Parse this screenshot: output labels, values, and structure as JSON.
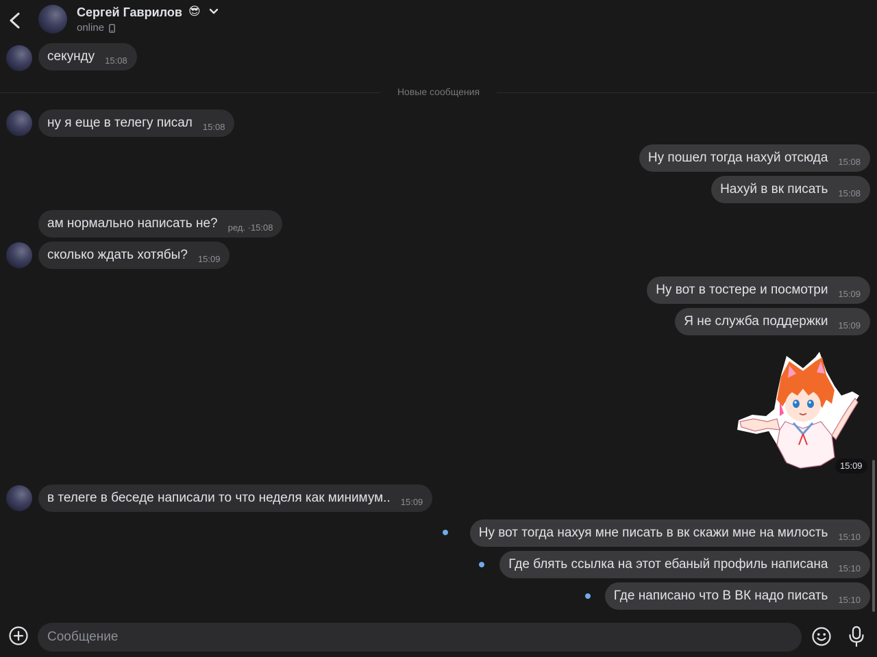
{
  "header": {
    "peer_name": "Сергей Гаврилов",
    "peer_emoji": "😎",
    "status": "online",
    "icons": [
      "back-arrow-icon",
      "chevron-down-icon",
      "phone-icon"
    ]
  },
  "divider": {
    "label": "Новые сообщения"
  },
  "messages": [
    {
      "dir": "in",
      "text": "секунду",
      "time": "15:08"
    },
    {
      "dir": "in",
      "text": "ну я еще в телегу писал",
      "time": "15:08"
    },
    {
      "dir": "out",
      "text": "Ну пошел тогда нахуй отсюда",
      "time": "15:08"
    },
    {
      "dir": "out",
      "text": "Нахуй в вк писать",
      "time": "15:08"
    },
    {
      "dir": "in",
      "text": "ам нормально написать не?",
      "edited": "ред.",
      "time": "15:08"
    },
    {
      "dir": "in",
      "text": "сколько ждать хотябы?",
      "time": "15:09"
    },
    {
      "dir": "out",
      "text": "Ну вот в тостере и посмотри",
      "time": "15:09"
    },
    {
      "dir": "out",
      "text": "Я не служба поддержки",
      "time": "15:09"
    },
    {
      "dir": "in",
      "text": "в телеге в беседе написали то что неделя как минимум..",
      "time": "15:09"
    },
    {
      "dir": "out",
      "text": "Ну вот тогда нахуя мне писать в вк скажи мне на милость",
      "time": "15:10",
      "unread": true
    },
    {
      "dir": "out",
      "text": "Где блять ссылка на этот ебаный профиль написана",
      "time": "15:10",
      "unread": true
    },
    {
      "dir": "out",
      "text": "Где написано что В ВК надо писать",
      "time": "15:10",
      "unread": true
    }
  ],
  "sticker": {
    "time": "15:09",
    "description_icon": "anime-fox-girl-sticker"
  },
  "composer": {
    "placeholder": "Сообщение",
    "icons": [
      "plus-circle-icon",
      "emoji-icon",
      "microphone-icon"
    ]
  },
  "colors": {
    "background": "#19191a",
    "bubble_in": "#2e2e30",
    "bubble_out": "#3a3a3c",
    "accent": "#71aaeb",
    "text": "#e1e3e6",
    "muted": "#8e9093"
  }
}
